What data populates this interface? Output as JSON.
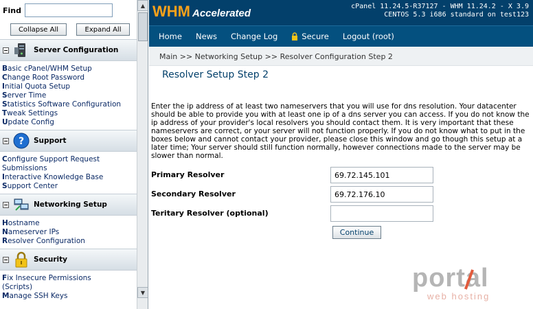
{
  "sidebar": {
    "find_label": "Find",
    "find_value": "",
    "collapse_all": "Collapse All",
    "expand_all": "Expand All",
    "sections": [
      {
        "title": "Server Configuration",
        "icon": "server-icon",
        "links": [
          {
            "first": "B",
            "rest": "asic cPanel/WHM Setup"
          },
          {
            "first": "C",
            "rest": "hange Root Password"
          },
          {
            "first": "I",
            "rest": "nitial Quota Setup"
          },
          {
            "first": "S",
            "rest": "erver Time"
          },
          {
            "first": "S",
            "rest": "tatistics Software Configuration"
          },
          {
            "first": "T",
            "rest": "weak Settings"
          },
          {
            "first": "U",
            "rest": "pdate Config"
          }
        ]
      },
      {
        "title": "Support",
        "icon": "help-icon",
        "links": [
          {
            "first": "C",
            "rest": "onfigure Support Request"
          },
          {
            "first": "",
            "rest": "Submissions"
          },
          {
            "first": "I",
            "rest": "nteractive Knowledge Base"
          },
          {
            "first": "S",
            "rest": "upport Center"
          }
        ]
      },
      {
        "title": "Networking Setup",
        "icon": "network-icon",
        "links": [
          {
            "first": "H",
            "rest": "ostname"
          },
          {
            "first": "N",
            "rest": "ameserver IPs"
          },
          {
            "first": "R",
            "rest": "esolver Configuration"
          }
        ]
      },
      {
        "title": "Security",
        "icon": "lock-icon",
        "links": [
          {
            "first": "F",
            "rest": "ix Insecure Permissions"
          },
          {
            "first": "",
            "rest": "(Scripts)"
          },
          {
            "first": "M",
            "rest": "anage SSH Keys"
          }
        ]
      }
    ]
  },
  "header": {
    "logo_main": "WHM",
    "logo_sub": "Accelerated",
    "version_line1": "cPanel 11.24.5-R37127 - WHM 11.24.2 - X 3.9",
    "version_line2": "CENTOS 5.3 i686 standard on test123"
  },
  "nav": {
    "items": [
      "Home",
      "News",
      "Change Log",
      "Secure",
      "Logout (root)"
    ]
  },
  "breadcrumb": "Main >> Networking Setup >> Resolver Configuration Step 2",
  "page": {
    "title": "Resolver Setup Step 2",
    "description": "Enter the ip address of at least two nameservers that you will use for dns resolution. Your datacenter should be able to provide you with at least one ip of a dns server you can access. If you do not know the ip address of your provider's local resolvers you should contact them. It is very important that these nameservers are correct, or your server will not function properly. If you do not know what to put in the boxes below and cannot contact your provider, please close this window and go though this setup at a later time; Your server should still function normally, however connections made to the server may be slower than normal.",
    "fields": [
      {
        "label": "Primary Resolver",
        "value": "69.72.145.101"
      },
      {
        "label": "Secondary Resolver",
        "value": "69.72.176.10"
      },
      {
        "label": "Teritary Resolver (optional)",
        "value": ""
      }
    ],
    "continue_label": "Continue"
  },
  "watermark": {
    "brand": "portal",
    "tagline": "web hosting"
  }
}
